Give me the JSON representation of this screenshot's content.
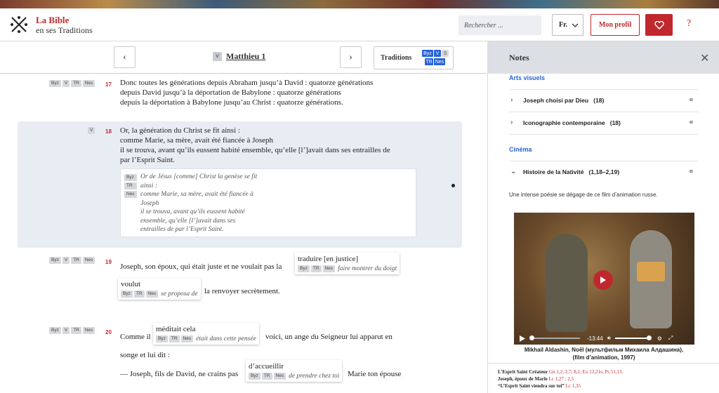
{
  "header": {
    "brand_line1": "La Bible",
    "brand_line2": "en ses Traditions",
    "search_placeholder": "Rechercher ...",
    "lang": "Fr.",
    "profile": "Mon profil",
    "help": "?",
    "colors": {
      "accent": "#c0282d",
      "link": "#2663d8"
    }
  },
  "nav": {
    "prev": "‹",
    "next": "›",
    "book_badge": "V",
    "book": "Matthieu 1",
    "traditions_label": "Traditions",
    "badges": [
      "Byz",
      "V",
      "S",
      "TR",
      "Nes"
    ]
  },
  "verses": [
    {
      "num": "17",
      "tags": [
        "Byz",
        "V",
        "TR",
        "Nes"
      ],
      "lines": [
        "Donc toutes les générations depuis Abraham jusqu’à David : quatorze générations",
        "depuis David jusqu’à la déportation de Babylone : quatorze générations",
        "depuis la déportation à Babylone jusqu’au Christ : quatorze générations."
      ]
    },
    {
      "num": "18",
      "tags": [
        "V"
      ],
      "lines": [
        "Or, la génération du Christ se fit ainsi :",
        "comme Marie, sa mère, avait été fiancée à Joseph",
        "il se trouva, avant qu’ils eussent habité ensemble, qu’elle [l’]avait dans ses entrailles de",
        "par l’Esprit Saint."
      ],
      "alt": {
        "tags": [
          "Byz",
          "TR",
          "Nes"
        ],
        "lines": [
          "Or de Jésus [comme] Christ la genèse se fit",
          "ainsi :",
          "comme Marie, sa mère, avait été fiancée à",
          "Joseph",
          "il se trouva, avant qu’ils eussent habité",
          "ensemble, qu’elle [l’]avait dans ses",
          "entrailles de par l’Esprit Saint."
        ]
      }
    },
    {
      "num": "19",
      "tags": [
        "Byz",
        "V",
        "TR",
        "Nes"
      ],
      "pre": "Joseph, son époux, qui était juste et ne voulait pas la",
      "w1": "traduire [en justice]",
      "g1": "faire montrer du doigt",
      "w2": "voulut",
      "g2": "se proposa de",
      "post": "la renvoyer secrètement."
    },
    {
      "num": "20",
      "tags": [
        "Byz",
        "V",
        "TR",
        "Nes"
      ],
      "pre": "Comme il",
      "w1": "méditait cela",
      "g1": "était dans cette pensée",
      "mid": "voici, un ange du Seigneur lui apparut en",
      "line2": "songe et lui dit :",
      "pre3": "— Joseph, fils de David, ne crains pas",
      "w2": "d’accueillir",
      "g2": "de prendre chez toi",
      "post3": "Marie ton épouse"
    }
  ],
  "gloss_tags": [
    "Byz",
    "TR",
    "Nes"
  ],
  "notes": {
    "title": "Notes",
    "close": "✕",
    "section1": "Arts visuels",
    "items1": [
      {
        "label": "Joseph choisi par Dieu",
        "count": "(18)"
      },
      {
        "label": "Iconographie contemporaine",
        "count": "(18)"
      }
    ],
    "section2": "Cinéma",
    "item2": {
      "label": "Histoire de la Nativité",
      "count": "(1,18–2,19)"
    },
    "description": "Une intense poésie se dégage de ce film d’animation russe.",
    "video_time": "-13:44",
    "caption1": "Mikhail Aldashin, Noël (мультфильм Михаила Алдашина),",
    "caption2": "(film d’animation, 1997)",
    "refs": [
      {
        "label": "L’Esprit Saint Créateur",
        "refs": "Gn 1,2; 2,7; 8,1; Ex 13,21s; Ps 51,13."
      },
      {
        "label": "Joseph, époux de Marie",
        "refs": "Lc 1,27 ; 2,5"
      },
      {
        "label": "“L’Esprit Saint viendra sur toi”",
        "refs": "Lc 1,35"
      }
    ]
  }
}
